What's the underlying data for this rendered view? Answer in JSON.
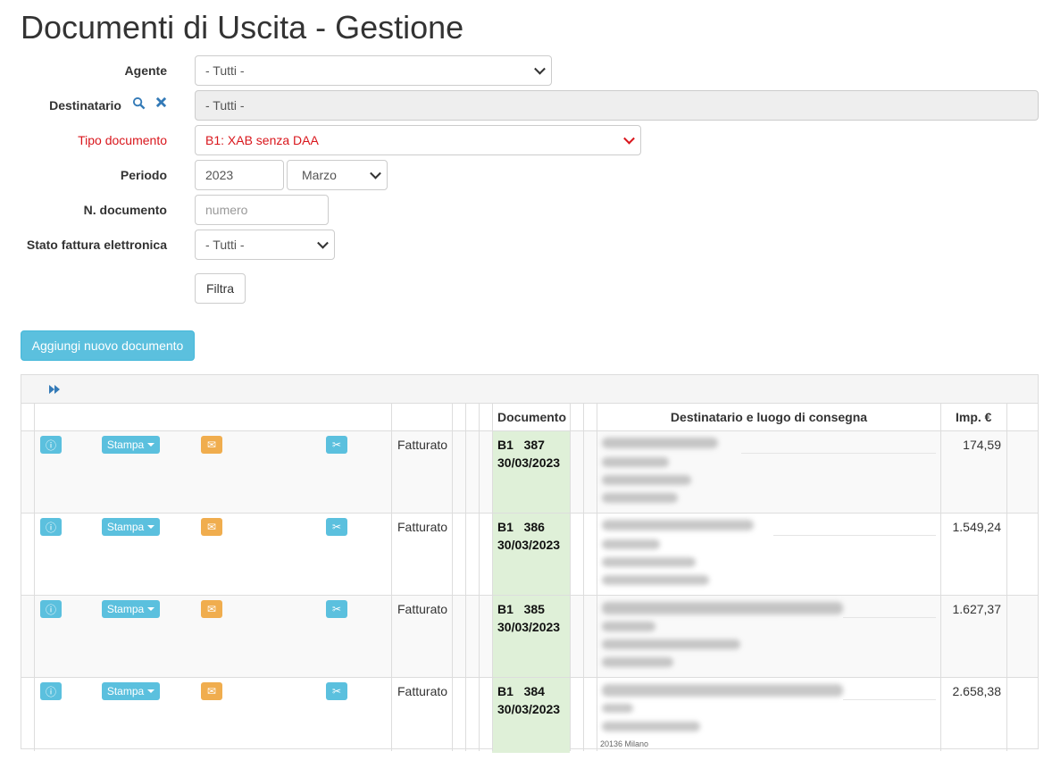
{
  "page_title": "Documenti di Uscita - Gestione",
  "filters": {
    "agente": {
      "label": "Agente",
      "value": "- Tutti -"
    },
    "destinatario": {
      "label": "Destinatario",
      "value": "- Tutti -"
    },
    "tipo_documento": {
      "label": "Tipo documento",
      "value": "B1: XAB senza DAA"
    },
    "periodo": {
      "label": "Periodo",
      "year": "2023",
      "month": "Marzo"
    },
    "n_documento": {
      "label": "N. documento",
      "placeholder": "numero"
    },
    "stato_fattura": {
      "label": "Stato fattura elettronica",
      "value": "- Tutti -"
    }
  },
  "buttons": {
    "filtra": "Filtra",
    "add": "Aggiungi nuovo documento"
  },
  "table": {
    "headers": {
      "documento": "Documento",
      "destinatario": "Destinatario e luogo di consegna",
      "importo": "Imp. €"
    },
    "stampa_label": "Stampa",
    "rows": [
      {
        "status": "Fatturato",
        "type": "B1",
        "number": "387",
        "date": "30/03/2023",
        "amount": "174,59"
      },
      {
        "status": "Fatturato",
        "type": "B1",
        "number": "386",
        "date": "30/03/2023",
        "amount": "1.549,24"
      },
      {
        "status": "Fatturato",
        "type": "B1",
        "number": "385",
        "date": "30/03/2023",
        "amount": "1.627,37"
      },
      {
        "status": "Fatturato",
        "type": "B1",
        "number": "384",
        "date": "30/03/2023",
        "amount": "2.658,38"
      }
    ],
    "last_row_fragment": "20136 Milano"
  },
  "colors": {
    "info": "#5bc0de",
    "warning": "#f0ad4e",
    "doc_bg": "#dff0d8",
    "required_label": "#d9161c",
    "link": "#337ab7"
  }
}
